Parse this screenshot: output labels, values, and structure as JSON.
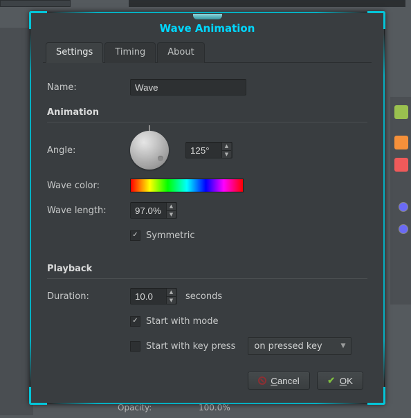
{
  "title": "Wave Animation",
  "tabs": {
    "settings": "Settings",
    "timing": "Timing",
    "about": "About"
  },
  "name": {
    "label": "Name:",
    "value": "Wave"
  },
  "sections": {
    "animation": "Animation",
    "playback": "Playback"
  },
  "angle": {
    "label": "Angle:",
    "value": "125°"
  },
  "wave_color": {
    "label": "Wave color:"
  },
  "wave_length": {
    "label": "Wave length:",
    "value": "97.0%"
  },
  "symmetric": {
    "label": "Symmetric",
    "checked": true
  },
  "duration": {
    "label": "Duration:",
    "value": "10.0",
    "suffix": "seconds"
  },
  "start_mode": {
    "label": "Start with mode",
    "checked": true
  },
  "start_key": {
    "label": "Start with key press",
    "checked": false
  },
  "key_combo": {
    "value": "on pressed key"
  },
  "buttons": {
    "cancel_u": "C",
    "cancel_rest": "ancel",
    "ok_u": "O",
    "ok_rest": "K"
  },
  "bg": {
    "opacity_label": "Opacity:",
    "opacity_value": "100.0%"
  }
}
